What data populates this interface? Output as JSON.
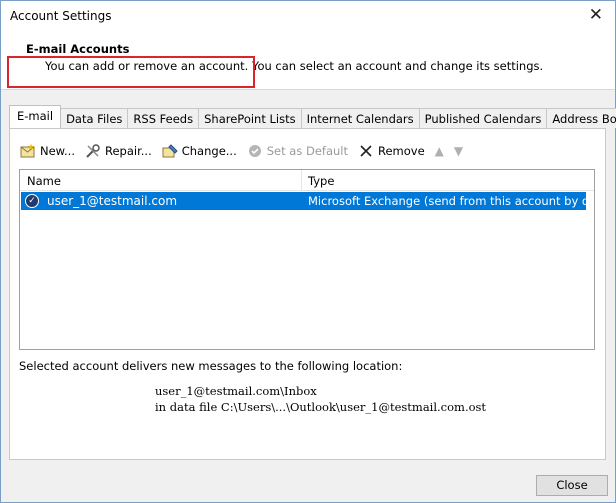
{
  "window": {
    "title": "Account Settings",
    "close_glyph": "✕"
  },
  "header": {
    "title": "E-mail Accounts",
    "subtitle": "You can add or remove an account. You can select an account and change its settings."
  },
  "tabs": [
    {
      "label": "E-mail",
      "active": true
    },
    {
      "label": "Data Files"
    },
    {
      "label": "RSS Feeds"
    },
    {
      "label": "SharePoint Lists"
    },
    {
      "label": "Internet Calendars"
    },
    {
      "label": "Published Calendars"
    },
    {
      "label": "Address Books"
    }
  ],
  "toolbar": {
    "new_label": "New...",
    "repair_label": "Repair...",
    "change_label": "Change...",
    "default_label": "Set as Default",
    "remove_label": "Remove",
    "up_glyph": "▲",
    "down_glyph": "▼"
  },
  "list": {
    "col_name": "Name",
    "col_type": "Type",
    "rows": [
      {
        "name": "user_1@testmail.com",
        "type": "Microsoft Exchange (send from this account by def..."
      }
    ]
  },
  "delivery": {
    "label": "Selected account delivers new messages to the following location:",
    "location_line1": "user_1@testmail.com\\Inbox",
    "location_line2": "in data file C:\\Users\\...\\Outlook\\user_1@testmail.com.ost"
  },
  "footer": {
    "close_label": "Close"
  },
  "colors": {
    "selection": "#0078d7",
    "highlight": "#d9252b"
  }
}
